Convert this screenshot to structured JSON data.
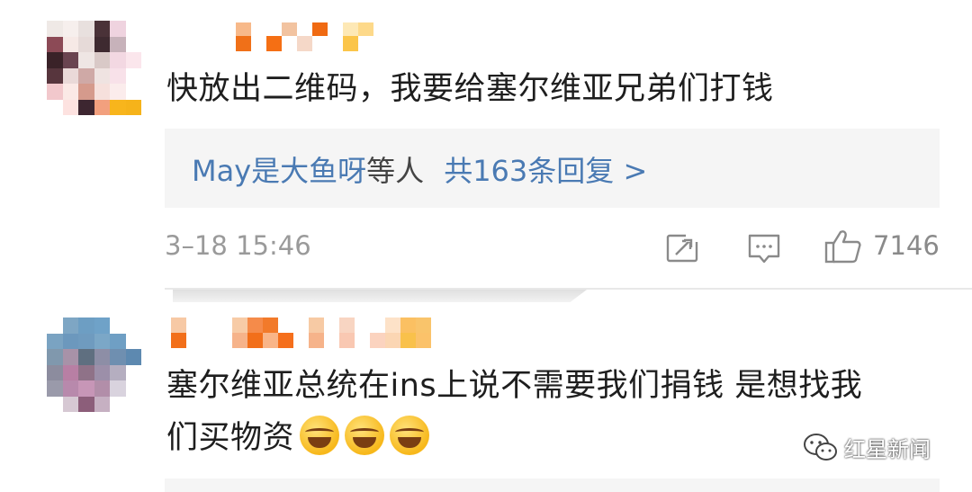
{
  "comments": [
    {
      "text": "快放出二维码，我要给塞尔维亚兄弟们打钱",
      "replies": {
        "who_name": "May是大鱼呀",
        "who_suffix": "等人",
        "count_text": "共163条回复 >"
      },
      "time": "3–18 15:46",
      "likes": "7146"
    },
    {
      "text_line1": "塞尔维亚总统在ins上说不需要我们捐钱  是想找我",
      "text_line2": "们买物资"
    }
  ],
  "icons": {
    "forward": "forward-icon",
    "reply": "reply-icon",
    "like": "thumbs-up-icon",
    "emoji": "tears-of-joy-emoji",
    "wechat": "wechat-icon"
  },
  "watermark": "红星新闻",
  "colors": {
    "link": "#4a7ab3",
    "meta": "#9a9a9a",
    "reply_bg": "#f5f5f5"
  }
}
